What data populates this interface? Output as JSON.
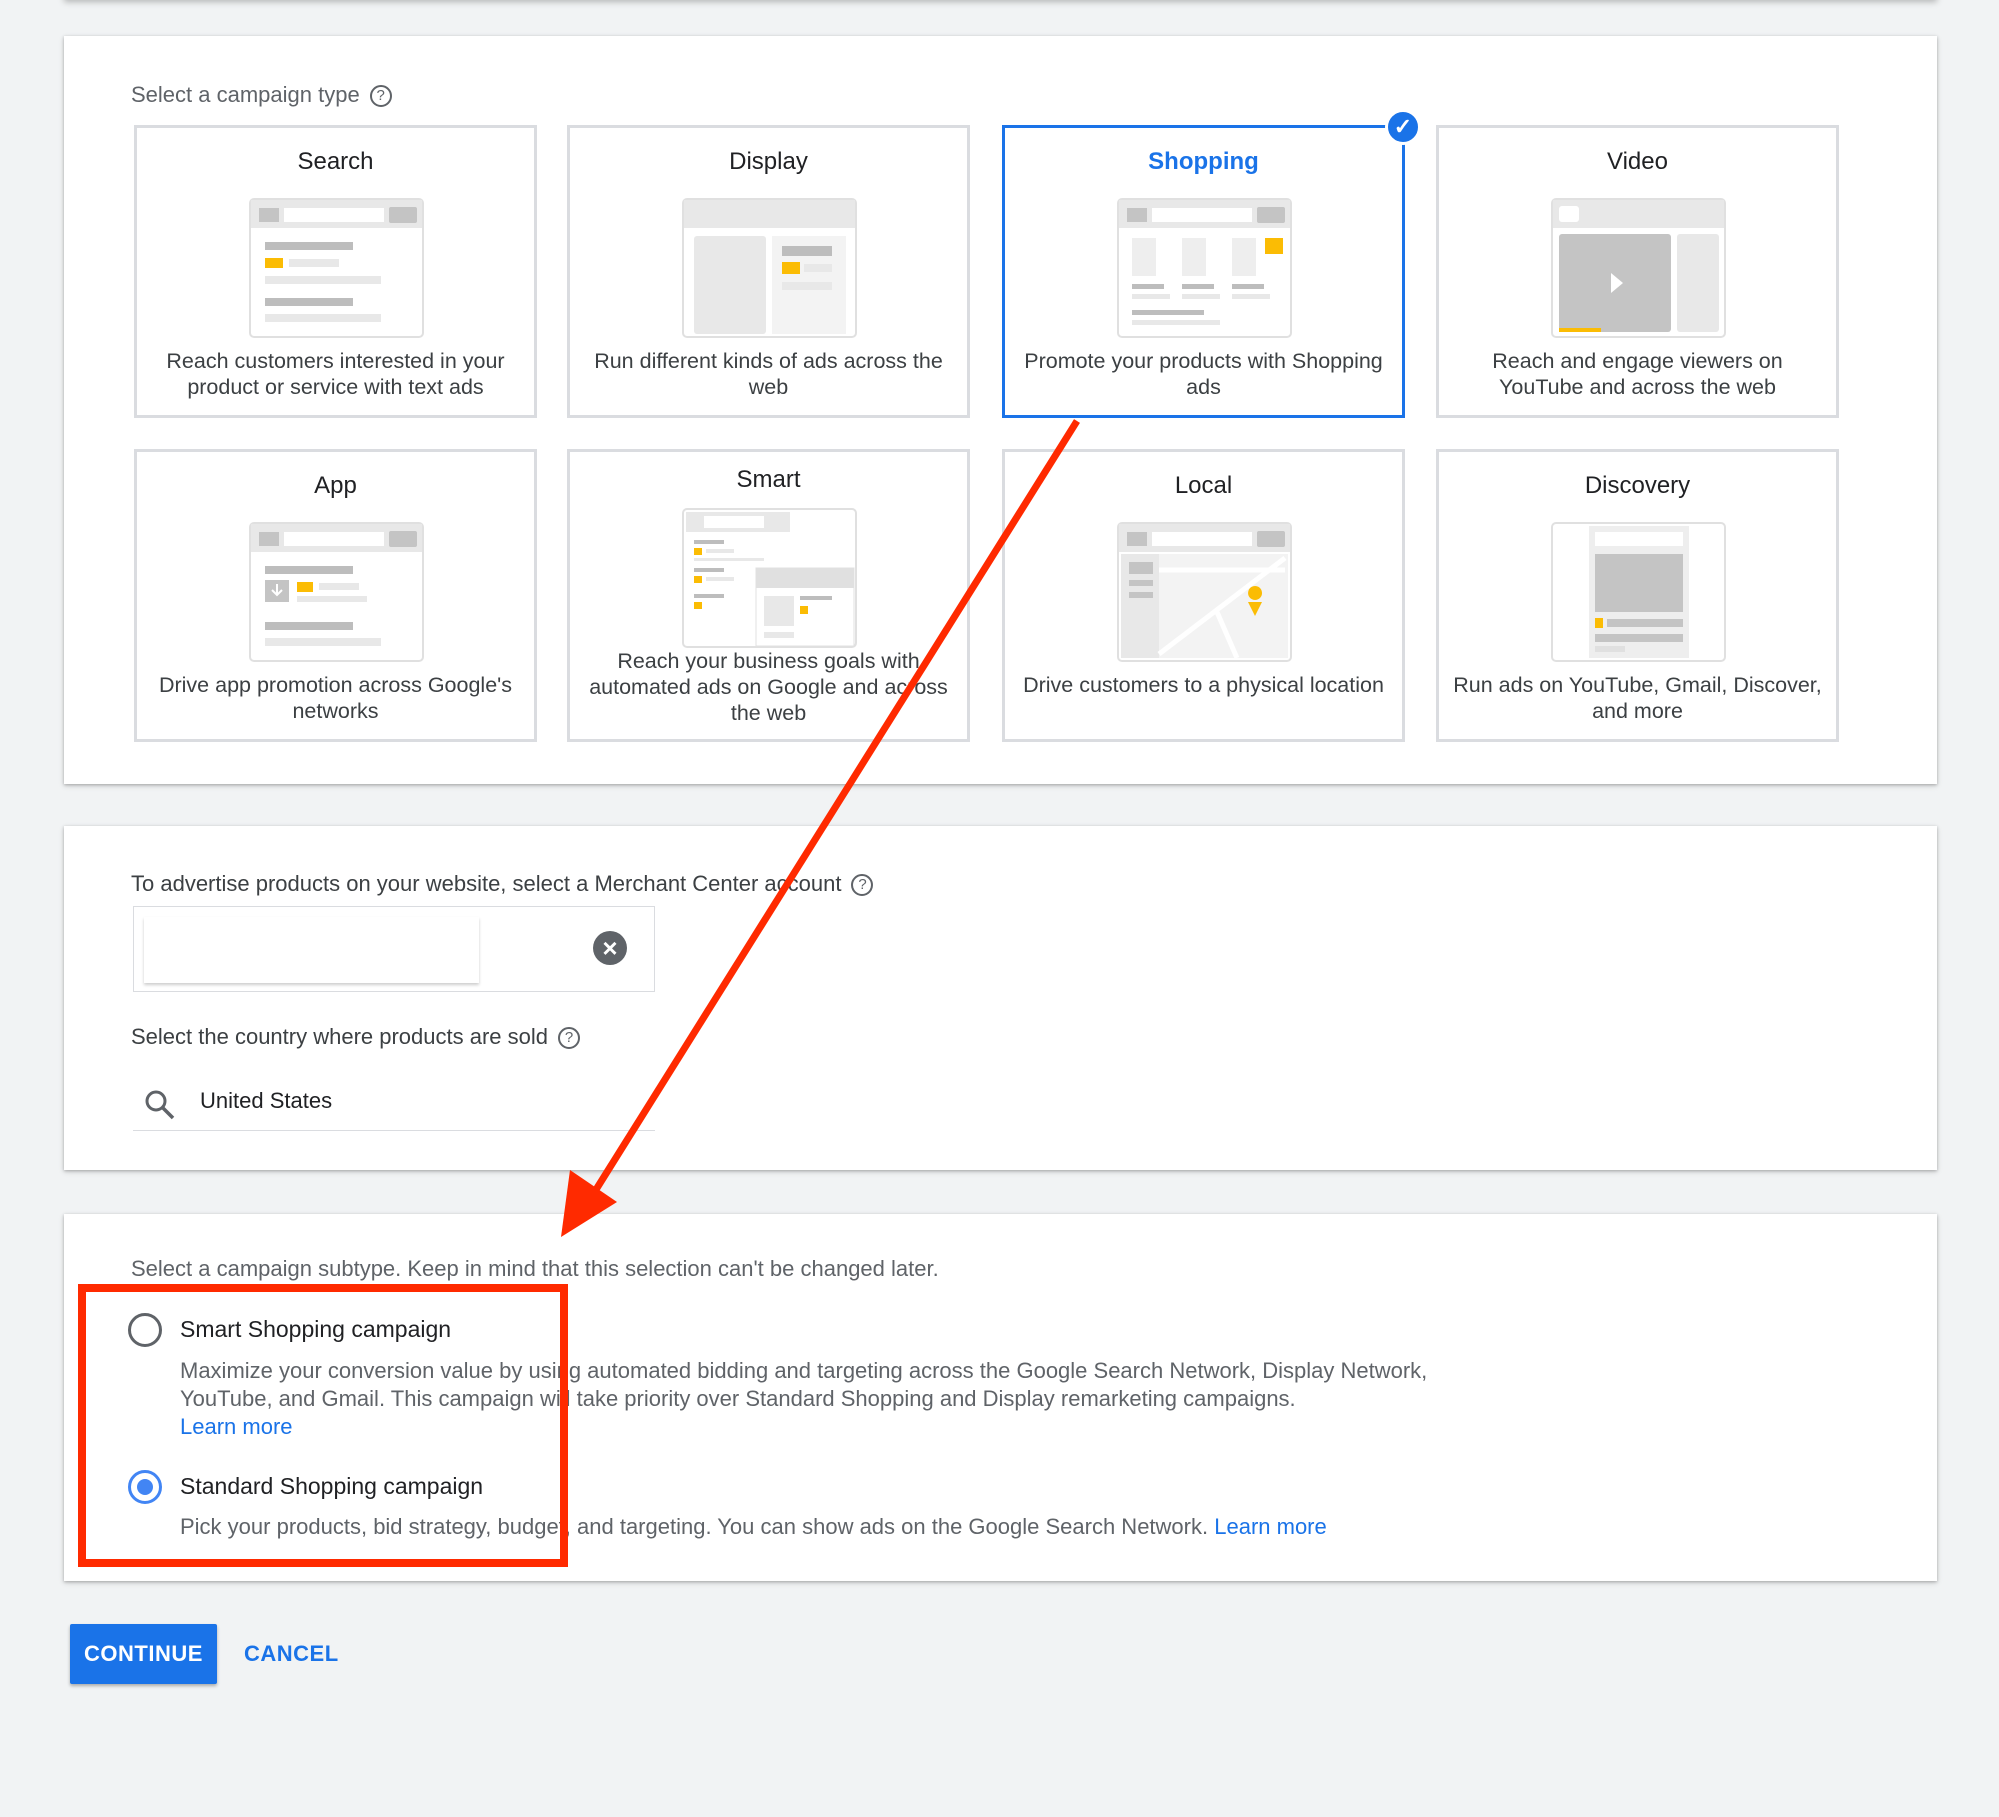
{
  "campaign_type": {
    "title": "Select a campaign type",
    "help_icon": "?",
    "selected": "Shopping",
    "tiles": [
      {
        "title": "Search",
        "description": "Reach customers interested in your product or service with text ads"
      },
      {
        "title": "Display",
        "description": "Run different kinds of ads across the web"
      },
      {
        "title": "Shopping",
        "description": "Promote your products with Shopping ads"
      },
      {
        "title": "Video",
        "description": "Reach and engage viewers on YouTube and across the web"
      },
      {
        "title": "App",
        "description": "Drive app promotion across Google's networks"
      },
      {
        "title": "Smart",
        "description": "Reach your business goals with automated ads on Google and across the web"
      },
      {
        "title": "Local",
        "description": "Drive customers to a physical location"
      },
      {
        "title": "Discovery",
        "description": "Run ads on YouTube, Gmail, Discover, and more"
      }
    ]
  },
  "merchant": {
    "label": "To advertise products on your website, select a Merchant Center account",
    "value": "",
    "clear_icon": "×",
    "country_label": "Select the country where products are sold",
    "country_value": "United States"
  },
  "subtype": {
    "label": "Select a campaign subtype. Keep in mind that this selection can't be changed later.",
    "options": [
      {
        "title": "Smart Shopping campaign",
        "description": "Maximize your conversion value by using automated bidding and targeting across the Google Search Network, Display Network, YouTube, and Gmail. This campaign will take priority over Standard Shopping and Display remarketing campaigns.",
        "link": "Learn more",
        "selected": false
      },
      {
        "title": "Standard Shopping campaign",
        "description": "Pick your products, bid strategy, budget, and targeting. You can show ads on the Google Search Network.",
        "link": "Learn more",
        "selected": true
      }
    ]
  },
  "actions": {
    "continue": "CONTINUE",
    "cancel": "CANCEL"
  },
  "colors": {
    "accent": "#1a73e8",
    "annotation": "#ff2a00",
    "ad_yellow": "#fbbc04"
  }
}
